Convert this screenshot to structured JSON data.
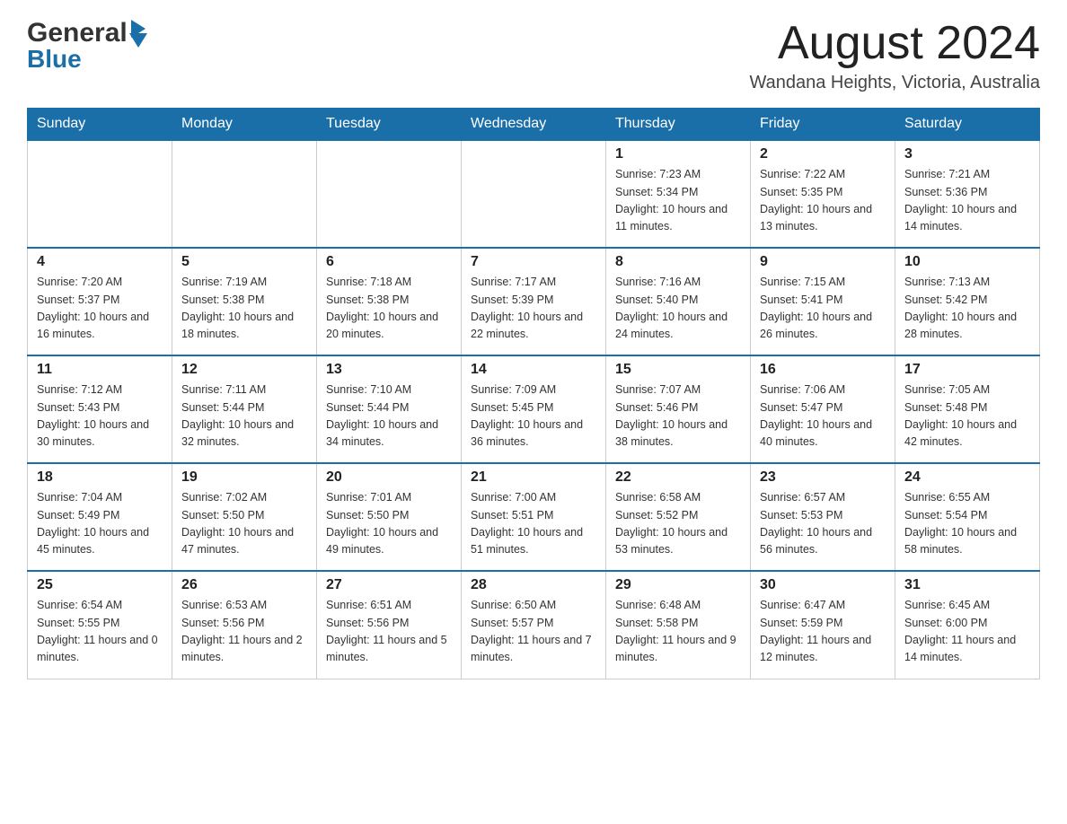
{
  "header": {
    "logo_general": "General",
    "logo_blue": "Blue",
    "month_title": "August 2024",
    "location": "Wandana Heights, Victoria, Australia"
  },
  "days_of_week": [
    "Sunday",
    "Monday",
    "Tuesday",
    "Wednesday",
    "Thursday",
    "Friday",
    "Saturday"
  ],
  "weeks": [
    [
      {
        "day": "",
        "info": ""
      },
      {
        "day": "",
        "info": ""
      },
      {
        "day": "",
        "info": ""
      },
      {
        "day": "",
        "info": ""
      },
      {
        "day": "1",
        "info": "Sunrise: 7:23 AM\nSunset: 5:34 PM\nDaylight: 10 hours and 11 minutes."
      },
      {
        "day": "2",
        "info": "Sunrise: 7:22 AM\nSunset: 5:35 PM\nDaylight: 10 hours and 13 minutes."
      },
      {
        "day": "3",
        "info": "Sunrise: 7:21 AM\nSunset: 5:36 PM\nDaylight: 10 hours and 14 minutes."
      }
    ],
    [
      {
        "day": "4",
        "info": "Sunrise: 7:20 AM\nSunset: 5:37 PM\nDaylight: 10 hours and 16 minutes."
      },
      {
        "day": "5",
        "info": "Sunrise: 7:19 AM\nSunset: 5:38 PM\nDaylight: 10 hours and 18 minutes."
      },
      {
        "day": "6",
        "info": "Sunrise: 7:18 AM\nSunset: 5:38 PM\nDaylight: 10 hours and 20 minutes."
      },
      {
        "day": "7",
        "info": "Sunrise: 7:17 AM\nSunset: 5:39 PM\nDaylight: 10 hours and 22 minutes."
      },
      {
        "day": "8",
        "info": "Sunrise: 7:16 AM\nSunset: 5:40 PM\nDaylight: 10 hours and 24 minutes."
      },
      {
        "day": "9",
        "info": "Sunrise: 7:15 AM\nSunset: 5:41 PM\nDaylight: 10 hours and 26 minutes."
      },
      {
        "day": "10",
        "info": "Sunrise: 7:13 AM\nSunset: 5:42 PM\nDaylight: 10 hours and 28 minutes."
      }
    ],
    [
      {
        "day": "11",
        "info": "Sunrise: 7:12 AM\nSunset: 5:43 PM\nDaylight: 10 hours and 30 minutes."
      },
      {
        "day": "12",
        "info": "Sunrise: 7:11 AM\nSunset: 5:44 PM\nDaylight: 10 hours and 32 minutes."
      },
      {
        "day": "13",
        "info": "Sunrise: 7:10 AM\nSunset: 5:44 PM\nDaylight: 10 hours and 34 minutes."
      },
      {
        "day": "14",
        "info": "Sunrise: 7:09 AM\nSunset: 5:45 PM\nDaylight: 10 hours and 36 minutes."
      },
      {
        "day": "15",
        "info": "Sunrise: 7:07 AM\nSunset: 5:46 PM\nDaylight: 10 hours and 38 minutes."
      },
      {
        "day": "16",
        "info": "Sunrise: 7:06 AM\nSunset: 5:47 PM\nDaylight: 10 hours and 40 minutes."
      },
      {
        "day": "17",
        "info": "Sunrise: 7:05 AM\nSunset: 5:48 PM\nDaylight: 10 hours and 42 minutes."
      }
    ],
    [
      {
        "day": "18",
        "info": "Sunrise: 7:04 AM\nSunset: 5:49 PM\nDaylight: 10 hours and 45 minutes."
      },
      {
        "day": "19",
        "info": "Sunrise: 7:02 AM\nSunset: 5:50 PM\nDaylight: 10 hours and 47 minutes."
      },
      {
        "day": "20",
        "info": "Sunrise: 7:01 AM\nSunset: 5:50 PM\nDaylight: 10 hours and 49 minutes."
      },
      {
        "day": "21",
        "info": "Sunrise: 7:00 AM\nSunset: 5:51 PM\nDaylight: 10 hours and 51 minutes."
      },
      {
        "day": "22",
        "info": "Sunrise: 6:58 AM\nSunset: 5:52 PM\nDaylight: 10 hours and 53 minutes."
      },
      {
        "day": "23",
        "info": "Sunrise: 6:57 AM\nSunset: 5:53 PM\nDaylight: 10 hours and 56 minutes."
      },
      {
        "day": "24",
        "info": "Sunrise: 6:55 AM\nSunset: 5:54 PM\nDaylight: 10 hours and 58 minutes."
      }
    ],
    [
      {
        "day": "25",
        "info": "Sunrise: 6:54 AM\nSunset: 5:55 PM\nDaylight: 11 hours and 0 minutes."
      },
      {
        "day": "26",
        "info": "Sunrise: 6:53 AM\nSunset: 5:56 PM\nDaylight: 11 hours and 2 minutes."
      },
      {
        "day": "27",
        "info": "Sunrise: 6:51 AM\nSunset: 5:56 PM\nDaylight: 11 hours and 5 minutes."
      },
      {
        "day": "28",
        "info": "Sunrise: 6:50 AM\nSunset: 5:57 PM\nDaylight: 11 hours and 7 minutes."
      },
      {
        "day": "29",
        "info": "Sunrise: 6:48 AM\nSunset: 5:58 PM\nDaylight: 11 hours and 9 minutes."
      },
      {
        "day": "30",
        "info": "Sunrise: 6:47 AM\nSunset: 5:59 PM\nDaylight: 11 hours and 12 minutes."
      },
      {
        "day": "31",
        "info": "Sunrise: 6:45 AM\nSunset: 6:00 PM\nDaylight: 11 hours and 14 minutes."
      }
    ]
  ]
}
